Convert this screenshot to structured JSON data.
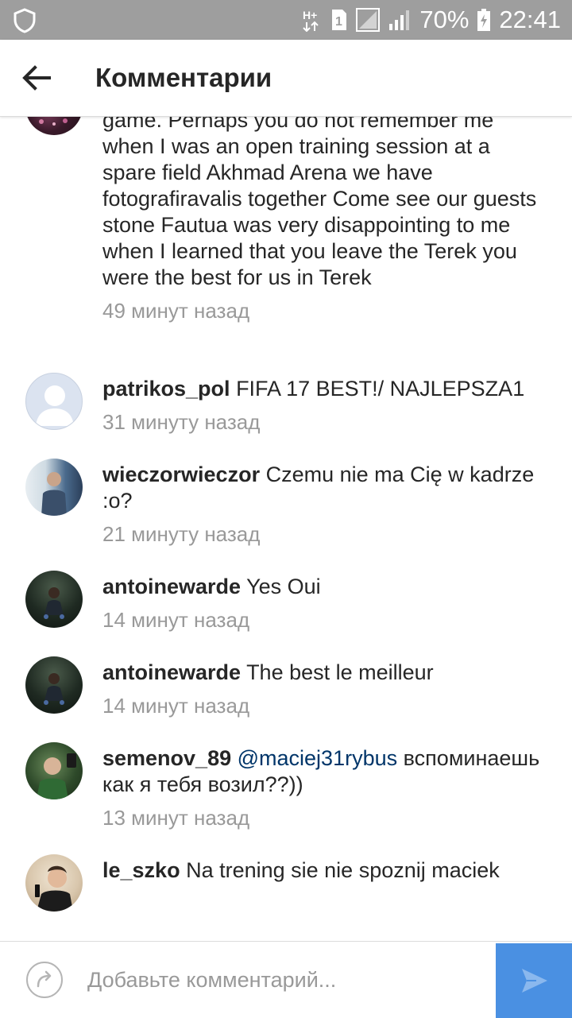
{
  "status_bar": {
    "network": "H+",
    "sim_slot": "1",
    "battery": "70%",
    "time": "22:41"
  },
  "header": {
    "title": "Комментарии"
  },
  "comments": [
    {
      "username": "",
      "text": "game. Perhaps you do not remember me when I was an open training session at a spare field Akhmad Arena we have fotografiravalis together Come see our guests stone Fautua was very disappointing to me when I learned that you leave the Terek you were the best for us in Terek",
      "time": "49 минут назад",
      "avatar": "night-stadium-photo"
    },
    {
      "username": "patrikos_pol",
      "text": "FIFA 17 BEST!/ NAJLEPSZA1",
      "time": "31 минуту назад",
      "avatar": "default-avatar"
    },
    {
      "username": "wieczorwieczor",
      "text": "Czemu nie ma Cię w kadrze :o?",
      "time": "21 минуту назад",
      "avatar": "man-in-corridor-photo"
    },
    {
      "username": "antoinewarde",
      "text": "Yes Oui",
      "time": "14 минут назад",
      "avatar": "man-crouching-photo"
    },
    {
      "username": "antoinewarde",
      "text": "The best le meilleur",
      "time": "14 минут назад",
      "avatar": "man-crouching-photo"
    },
    {
      "username": "semenov_89",
      "mention": "@maciej31rybus",
      "text": "вспоминаешь как я тебя возил??))",
      "time": "13 минут назад",
      "avatar": "man-in-green-photo"
    },
    {
      "username": "le_szko",
      "text": "Na trening sie nie spoznij maciek",
      "time": "",
      "avatar": "man-selfie-photo"
    }
  ],
  "composer": {
    "placeholder": "Добавьте комментарий..."
  },
  "colors": {
    "status_bar": "#9e9e9e",
    "send_button": "#4a90e2",
    "timestamp": "#999999",
    "mention": "#003569"
  }
}
